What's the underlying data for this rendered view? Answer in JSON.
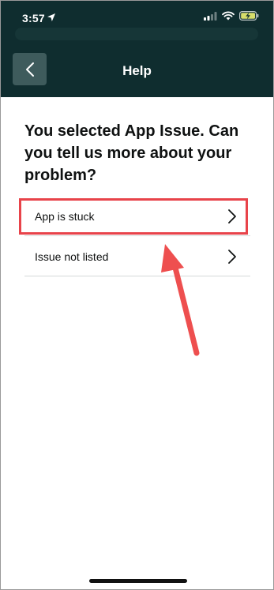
{
  "status_bar": {
    "time": "3:57"
  },
  "header": {
    "title": "Help"
  },
  "main": {
    "question": "You selected App Issue. Can you tell us more about your problem?",
    "options": [
      {
        "label": "App is stuck"
      },
      {
        "label": "Issue not listed"
      }
    ]
  },
  "icons": {
    "back": "back-chevron-icon",
    "location": "location-arrow-icon",
    "signal": "cellular-signal-icon",
    "wifi": "wifi-icon",
    "battery": "battery-charging-icon",
    "option_chevron": "chevron-right-icon"
  },
  "colors": {
    "header_bg": "#0f2d2f",
    "highlight": "#e8434a",
    "text": "#0f1111"
  }
}
